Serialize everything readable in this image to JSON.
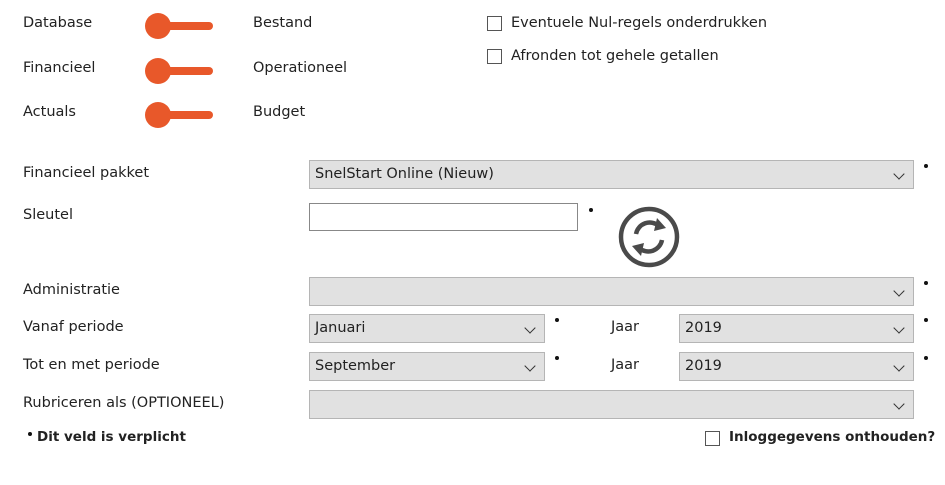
{
  "toggles": [
    {
      "left_label": "Database",
      "right_label": "Bestand"
    },
    {
      "left_label": "Financieel",
      "right_label": "Operationeel"
    },
    {
      "left_label": "Actuals",
      "right_label": "Budget"
    }
  ],
  "options": {
    "suppress_zero": {
      "label": "Eventuele Nul-regels onderdrukken",
      "checked": false
    },
    "round_whole": {
      "label": "Afronden tot gehele getallen",
      "checked": false
    }
  },
  "form": {
    "package": {
      "label": "Financieel pakket",
      "value": "SnelStart Online (Nieuw)"
    },
    "key": {
      "label": "Sleutel",
      "value": ""
    },
    "administration": {
      "label": "Administratie",
      "value": ""
    },
    "from_period": {
      "label": "Vanaf periode",
      "value": "Januari",
      "year_label": "Jaar",
      "year": "2019"
    },
    "to_period": {
      "label": "Tot en met periode",
      "value": "September",
      "year_label": "Jaar",
      "year": "2019"
    },
    "classify": {
      "label": "Rubriceren als (OPTIONEEL)",
      "value": ""
    }
  },
  "footer": {
    "required_note": "Dit veld is verplicht",
    "remember_login": "Inloggegevens onthouden?"
  },
  "icons": {
    "refresh": "refresh-icon"
  },
  "colors": {
    "accent": "#e8582a",
    "icon_gray": "#4a4a4a"
  }
}
